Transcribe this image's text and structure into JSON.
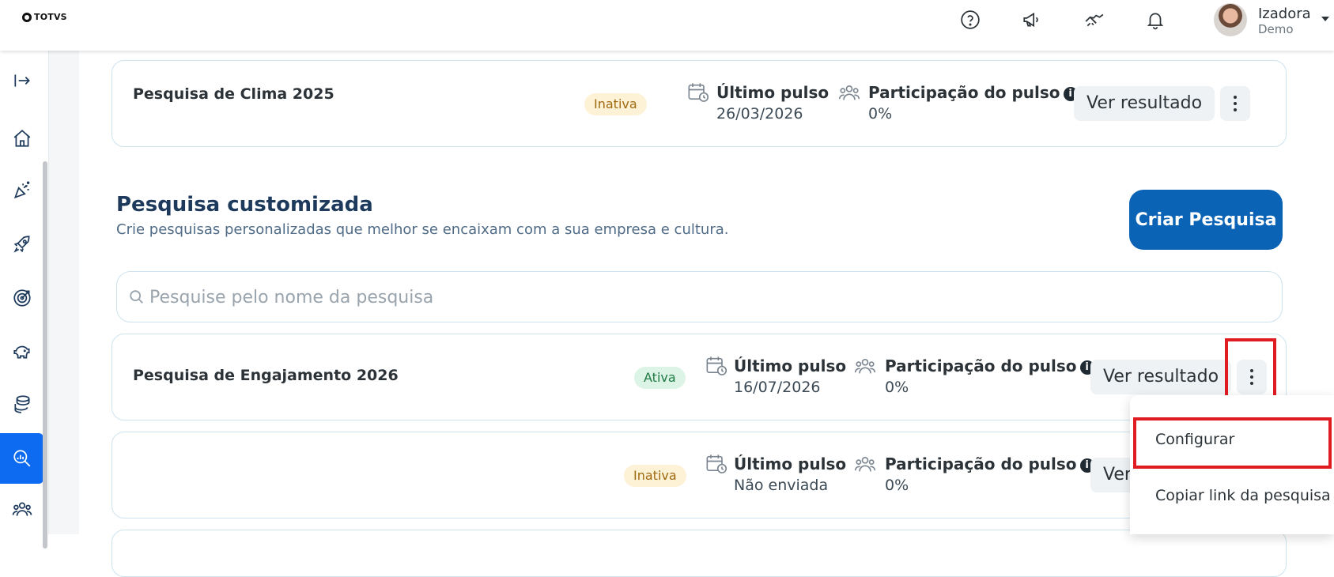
{
  "brand": {
    "logo_text": "TOTVS"
  },
  "header": {
    "icons": [
      "help-icon",
      "megaphone-icon",
      "handshake-icon",
      "bell-icon"
    ],
    "user": {
      "name": "Izadora",
      "role": "Demo"
    }
  },
  "sidebar": {
    "items": [
      "expand-icon",
      "home-icon",
      "celebration-icon",
      "rocket-icon",
      "target-icon",
      "piggy-bank-icon",
      "coins-icon",
      "survey-analytics-icon",
      "people-icon"
    ],
    "active_item": "survey-analytics-icon"
  },
  "climate_card": {
    "title": "Pesquisa de Clima 2025",
    "status": "Inativa",
    "last_pulse_label": "Último pulso",
    "last_pulse_value": "26/03/2026",
    "participation_label": "Participação do pulso",
    "participation_value": "0%",
    "result_button": "Ver resultado"
  },
  "custom_section": {
    "title": "Pesquisa customizada",
    "subtitle": "Crie pesquisas personalizadas que melhor se encaixam com a sua empresa e cultura.",
    "create_button": "Criar Pesquisa",
    "search_placeholder": "Pesquise pelo nome da pesquisa"
  },
  "surveys": [
    {
      "title": "Pesquisa de Engajamento 2026",
      "status": "Ativa",
      "last_pulse_label": "Último pulso",
      "last_pulse_value": "16/07/2026",
      "participation_label": "Participação do pulso",
      "participation_value": "0%",
      "result_button": "Ver resultado"
    },
    {
      "title": "",
      "status": "Inativa",
      "last_pulse_label": "Último pulso",
      "last_pulse_value": "Não enviada",
      "participation_label": "Participação do pulso",
      "participation_value": "0%",
      "result_button": "Ver"
    }
  ],
  "context_menu": {
    "items": [
      "Configurar",
      "Copiar link da pesquisa"
    ]
  },
  "colors": {
    "primary": "#0b63b6",
    "sidebar_active": "#0c6bf0",
    "highlight": "#e01b22",
    "badge_inactive_bg": "#fdf1d6",
    "badge_active_bg": "#dcf4e6"
  }
}
